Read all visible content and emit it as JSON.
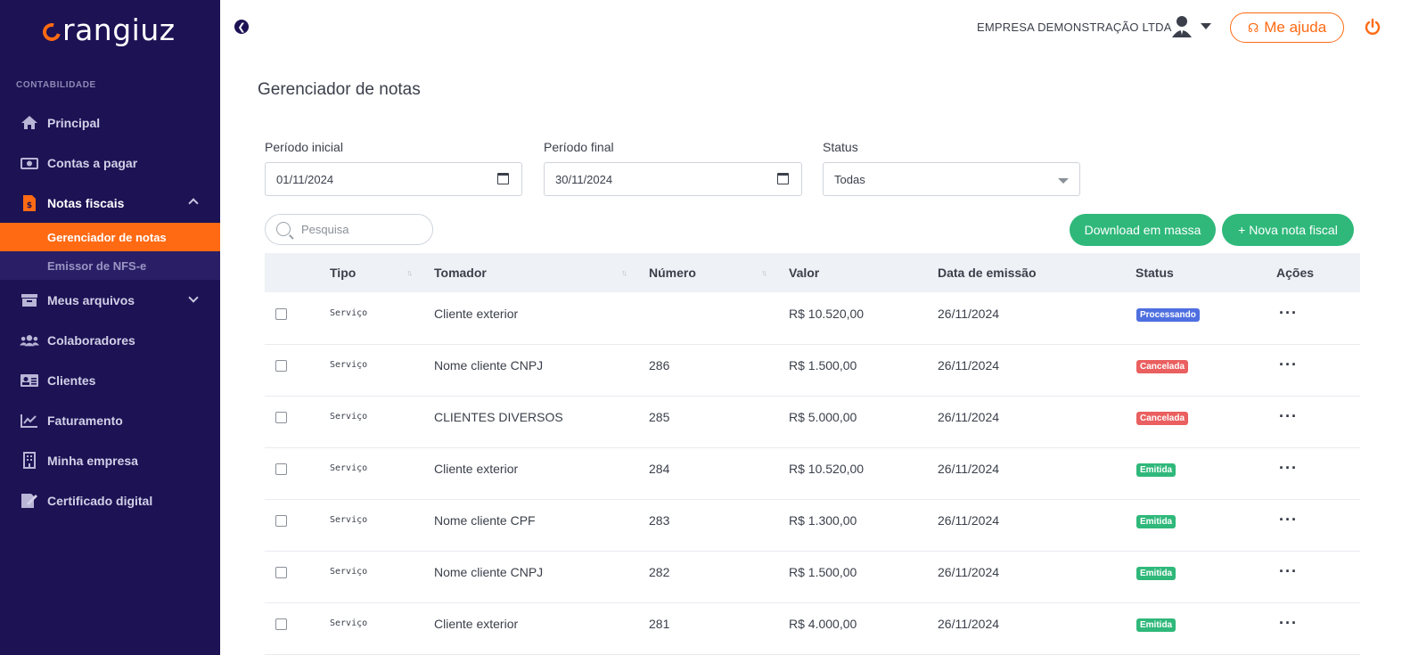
{
  "brand": {
    "logo_text": "rangiuz",
    "accent": "#ff6a13",
    "sidebar_bg": "#1c1254"
  },
  "sidebar": {
    "section": "CONTABILIDADE",
    "items": [
      {
        "label": "Principal",
        "icon": "home-icon"
      },
      {
        "label": "Contas a pagar",
        "icon": "money-icon"
      },
      {
        "label": "Notas fiscais",
        "icon": "invoice-icon",
        "expanded": true,
        "children": [
          {
            "label": "Gerenciador de notas",
            "active": true
          },
          {
            "label": "Emissor de NFS-e"
          }
        ]
      },
      {
        "label": "Meus arquivos",
        "icon": "archive-icon"
      },
      {
        "label": "Colaboradores",
        "icon": "users-icon"
      },
      {
        "label": "Clientes",
        "icon": "id-card-icon"
      },
      {
        "label": "Faturamento",
        "icon": "chart-line-icon"
      },
      {
        "label": "Minha empresa",
        "icon": "building-icon"
      },
      {
        "label": "Certificado digital",
        "icon": "certificate-icon"
      }
    ]
  },
  "header": {
    "company": "EMPRESA DEMONSTRAÇÃO LTDA",
    "help_label": "Me ajuda"
  },
  "page": {
    "title": "Gerenciador de notas"
  },
  "filters": {
    "start_label": "Período inicial",
    "start_value": "01/11/2024",
    "end_label": "Período final",
    "end_value": "30/11/2024",
    "status_label": "Status",
    "status_value": "Todas",
    "search_placeholder": "Pesquisa"
  },
  "actions": {
    "download": "Download em massa",
    "new_invoice": "+ Nova nota fiscal"
  },
  "table": {
    "columns": [
      "Tipo",
      "Tomador",
      "Número",
      "Valor",
      "Data de emissão",
      "Status",
      "Ações"
    ],
    "rows": [
      {
        "tipo": "Serviço",
        "tomador": "Cliente exterior",
        "numero": "",
        "valor": "R$ 10.520,00",
        "data": "26/11/2024",
        "status": "Processando",
        "status_color": "#4e6fe0"
      },
      {
        "tipo": "Serviço",
        "tomador": "Nome cliente CNPJ",
        "numero": "286",
        "valor": "R$ 1.500,00",
        "data": "26/11/2024",
        "status": "Cancelada",
        "status_color": "#ea5f5f"
      },
      {
        "tipo": "Serviço",
        "tomador": "CLIENTES DIVERSOS",
        "numero": "285",
        "valor": "R$ 5.000,00",
        "data": "26/11/2024",
        "status": "Cancelada",
        "status_color": "#ea5f5f"
      },
      {
        "tipo": "Serviço",
        "tomador": "Cliente exterior",
        "numero": "284",
        "valor": "R$ 10.520,00",
        "data": "26/11/2024",
        "status": "Emitida",
        "status_color": "#2fb87a"
      },
      {
        "tipo": "Serviço",
        "tomador": "Nome cliente CPF",
        "numero": "283",
        "valor": "R$ 1.300,00",
        "data": "26/11/2024",
        "status": "Emitida",
        "status_color": "#2fb87a"
      },
      {
        "tipo": "Serviço",
        "tomador": "Nome cliente CNPJ",
        "numero": "282",
        "valor": "R$ 1.500,00",
        "data": "26/11/2024",
        "status": "Emitida",
        "status_color": "#2fb87a"
      },
      {
        "tipo": "Serviço",
        "tomador": "Cliente exterior",
        "numero": "281",
        "valor": "R$ 4.000,00",
        "data": "26/11/2024",
        "status": "Emitida",
        "status_color": "#2fb87a"
      }
    ]
  }
}
